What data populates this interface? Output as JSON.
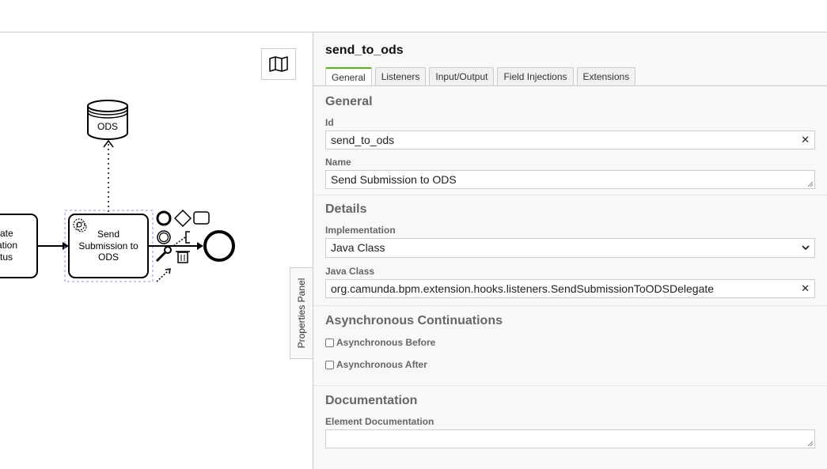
{
  "canvas": {
    "data_store_label": "ODS",
    "partial_task_lines": [
      "ate",
      "ation",
      "tus"
    ],
    "task_lines": [
      "Send",
      "Submission to",
      "ODS"
    ]
  },
  "properties_tab": {
    "label": "Properties Panel"
  },
  "panel": {
    "title": "send_to_ods",
    "tabs": [
      "General",
      "Listeners",
      "Input/Output",
      "Field Injections",
      "Extensions"
    ],
    "general": {
      "heading": "General",
      "id_label": "Id",
      "id_value": "send_to_ods",
      "name_label": "Name",
      "name_value": "Send Submission to ODS"
    },
    "details": {
      "heading": "Details",
      "implementation_label": "Implementation",
      "implementation_value": "Java Class",
      "java_class_label": "Java Class",
      "java_class_value": "org.camunda.bpm.extension.hooks.listeners.SendSubmissionToODSDelegate"
    },
    "async": {
      "heading": "Asynchronous Continuations",
      "before_label": "Asynchronous Before",
      "after_label": "Asynchronous After"
    },
    "documentation": {
      "heading": "Documentation",
      "element_doc_label": "Element Documentation"
    }
  },
  "colors": {
    "active_tab_accent": "#52b415",
    "selection_outline": "#8c8cff"
  }
}
